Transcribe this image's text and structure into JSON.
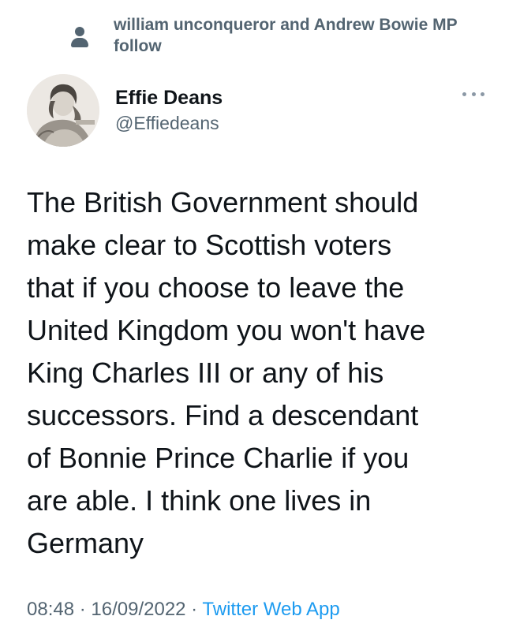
{
  "social_context": {
    "icon": "person-icon",
    "text": "william unconqueror and Andrew Bowie MP follow"
  },
  "author": {
    "display_name": "Effie Deans",
    "handle": "@Effiedeans",
    "avatar": "portrait-engraving-avatar"
  },
  "more_menu": {
    "icon": "more-dots-icon"
  },
  "tweet": {
    "text": "The British Government should\nmake clear to Scottish voters\nthat if you choose to leave the\nUnited Kingdom you won't have\nKing Charles III or any of his\nsuccessors. Find a descendant\nof Bonnie Prince Charlie if you\nare able. I think one lives in\nGermany"
  },
  "meta": {
    "time": "08:48",
    "separator": " · ",
    "date": "16/09/2022",
    "source": "Twitter Web App"
  },
  "colors": {
    "primary_text": "#0f1419",
    "secondary_text": "#536471",
    "link": "#1d9bf0"
  }
}
